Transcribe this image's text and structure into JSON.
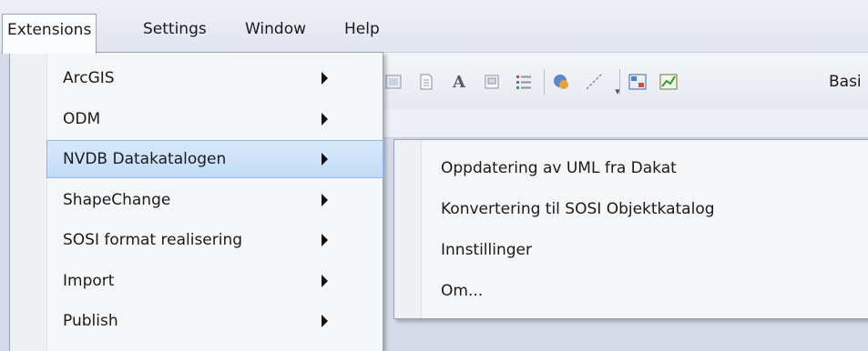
{
  "menubar": {
    "items": [
      {
        "label": "Extensions"
      },
      {
        "label": "Settings"
      },
      {
        "label": "Window"
      },
      {
        "label": "Help"
      }
    ]
  },
  "toolbar": {
    "icons": [
      "image-icon",
      "document-icon",
      "text-a-icon",
      "note-icon",
      "list-icon",
      "connector-icon",
      "line-icon",
      "overflow-icon",
      "diagram-icon",
      "chart-icon"
    ],
    "partial_label": "Basi"
  },
  "extensions_menu": {
    "items": [
      {
        "label": "ArcGIS",
        "has_submenu": true
      },
      {
        "label": "ODM",
        "has_submenu": true
      },
      {
        "label": "NVDB Datakatalogen",
        "has_submenu": true,
        "highlighted": true
      },
      {
        "label": "ShapeChange",
        "has_submenu": true
      },
      {
        "label": "SOSI format realisering",
        "has_submenu": true
      },
      {
        "label": "Import",
        "has_submenu": true
      },
      {
        "label": "Publish",
        "has_submenu": true
      }
    ]
  },
  "submenu": {
    "items": [
      {
        "label": "Oppdatering av UML fra Dakat"
      },
      {
        "label": "Konvertering til SOSI Objektkatalog"
      },
      {
        "label": "Innstillinger"
      },
      {
        "label": "Om..."
      }
    ]
  },
  "colors": {
    "highlight": "#c2dcf7",
    "highlight_border": "#8fb6e6",
    "menu_bg": "#f5f6f7",
    "workspace_bg": "#d6dbe9"
  }
}
